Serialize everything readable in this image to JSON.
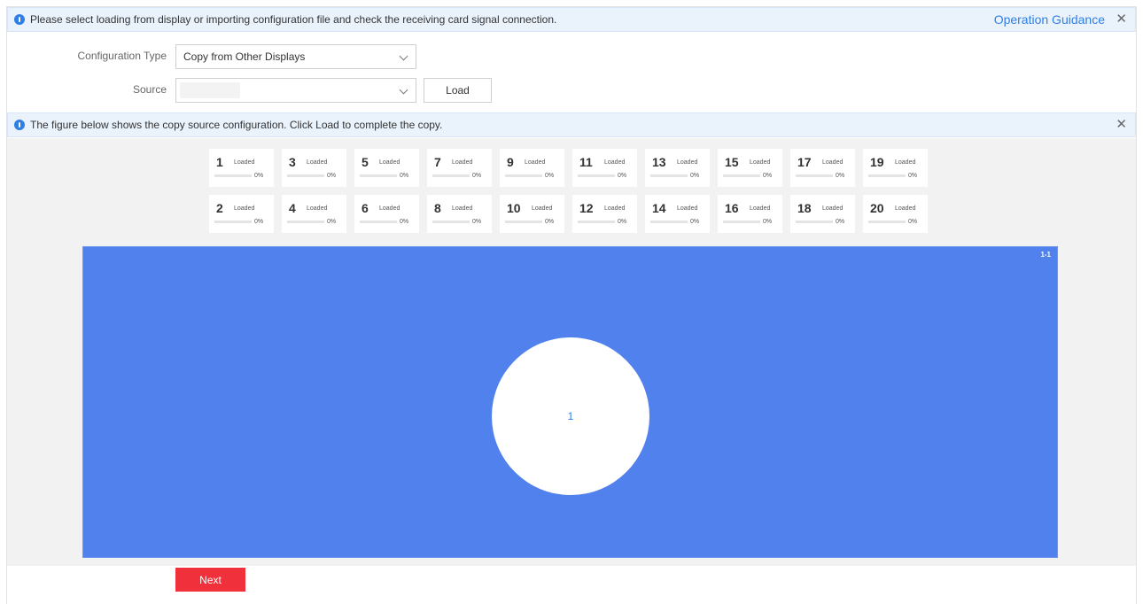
{
  "top_banner": {
    "icon": "info-icon",
    "text": "Please select loading from display or importing configuration file and check the receiving card signal connection.",
    "link": "Operation Guidance",
    "close": "✕"
  },
  "form": {
    "config_type_label": "Configuration Type",
    "config_type_value": "Copy from Other Displays",
    "source_label": "Source",
    "source_value": "",
    "load_button": "Load"
  },
  "mid_banner": {
    "icon": "info-icon",
    "text": "The figure below shows the copy source configuration. Click Load to complete the copy.",
    "close": "✕"
  },
  "cards": {
    "rows": [
      [
        {
          "num": "1",
          "status": "Loaded",
          "pct": "0%",
          "progress": 0
        },
        {
          "num": "3",
          "status": "Loaded",
          "pct": "0%",
          "progress": 0
        },
        {
          "num": "5",
          "status": "Loaded",
          "pct": "0%",
          "progress": 0
        },
        {
          "num": "7",
          "status": "Loaded",
          "pct": "0%",
          "progress": 0
        },
        {
          "num": "9",
          "status": "Loaded",
          "pct": "0%",
          "progress": 0
        },
        {
          "num": "11",
          "status": "Loaded",
          "pct": "0%",
          "progress": 0
        },
        {
          "num": "13",
          "status": "Loaded",
          "pct": "0%",
          "progress": 0
        },
        {
          "num": "15",
          "status": "Loaded",
          "pct": "0%",
          "progress": 0
        },
        {
          "num": "17",
          "status": "Loaded",
          "pct": "0%",
          "progress": 0
        },
        {
          "num": "19",
          "status": "Loaded",
          "pct": "0%",
          "progress": 0
        }
      ],
      [
        {
          "num": "2",
          "status": "Loaded",
          "pct": "0%",
          "progress": 0
        },
        {
          "num": "4",
          "status": "Loaded",
          "pct": "0%",
          "progress": 0
        },
        {
          "num": "6",
          "status": "Loaded",
          "pct": "0%",
          "progress": 0
        },
        {
          "num": "8",
          "status": "Loaded",
          "pct": "0%",
          "progress": 0
        },
        {
          "num": "10",
          "status": "Loaded",
          "pct": "0%",
          "progress": 0
        },
        {
          "num": "12",
          "status": "Loaded",
          "pct": "0%",
          "progress": 0
        },
        {
          "num": "14",
          "status": "Loaded",
          "pct": "0%",
          "progress": 0
        },
        {
          "num": "16",
          "status": "Loaded",
          "pct": "0%",
          "progress": 0
        },
        {
          "num": "18",
          "status": "Loaded",
          "pct": "0%",
          "progress": 0
        },
        {
          "num": "20",
          "status": "Loaded",
          "pct": "0%",
          "progress": 0
        }
      ]
    ]
  },
  "panel": {
    "tag": "1-1",
    "circle_label": "1"
  },
  "next_button": "Next",
  "colors": {
    "accent": "#2f7fe6",
    "panel_blue": "#5181ed",
    "next_red": "#f0303a",
    "banner_bg": "#eaf2fc"
  }
}
